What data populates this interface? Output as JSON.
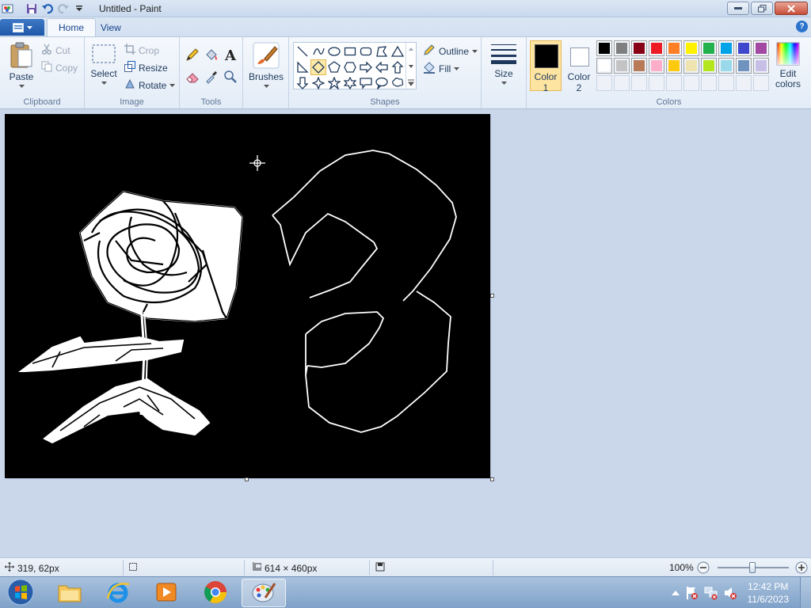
{
  "window": {
    "title": "Untitled - Paint"
  },
  "ribbon": {
    "tabs": [
      "Home",
      "View"
    ],
    "clipboard": {
      "paste": "Paste",
      "cut": "Cut",
      "copy": "Copy",
      "label": "Clipboard"
    },
    "image": {
      "select": "Select",
      "crop": "Crop",
      "resize": "Resize",
      "rotate": "Rotate",
      "label": "Image"
    },
    "tools": {
      "label": "Tools"
    },
    "brushes": {
      "label": "Brushes"
    },
    "shapes": {
      "outline": "Outline",
      "fill": "Fill",
      "label": "Shapes"
    },
    "size": {
      "label": "Size"
    },
    "colors": {
      "color1_label": "Color",
      "color1_num": "1",
      "color2_label": "Color",
      "color2_num": "2",
      "edit_label_1": "Edit",
      "edit_label_2": "colors",
      "group_label": "Colors",
      "color1": "#000000",
      "color2": "#ffffff",
      "palette_row1": [
        "#000000",
        "#7f7f7f",
        "#880015",
        "#ed1c24",
        "#ff7f27",
        "#fff200",
        "#22b14c",
        "#00a2e8",
        "#3f48cc",
        "#a349a4"
      ],
      "palette_row2": [
        "#ffffff",
        "#c3c3c3",
        "#b97a57",
        "#ffaec9",
        "#ffc90e",
        "#efe4b0",
        "#b5e61d",
        "#99d9ea",
        "#7092be",
        "#c8bfe7"
      ]
    }
  },
  "status": {
    "cursor_pos": "319, 62px",
    "canvas_size": "614 × 460px",
    "zoom": "100%"
  },
  "taskbar": {
    "time": "12:42 PM",
    "date": "11/6/2023"
  }
}
